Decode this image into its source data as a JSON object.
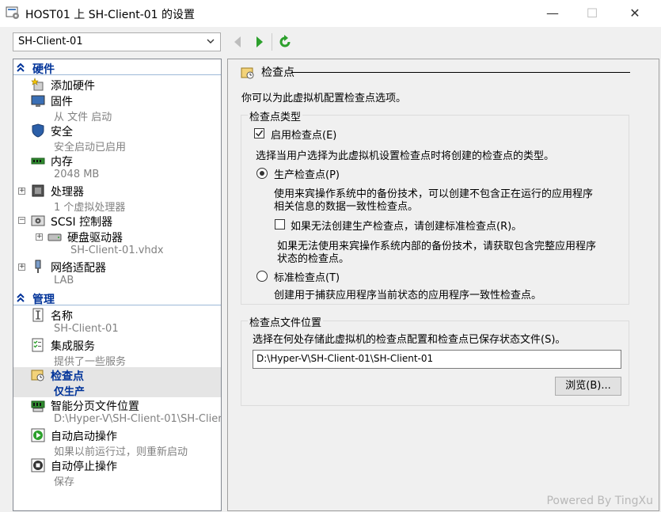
{
  "window": {
    "title": "HOST01 上 SH-Client-01 的设置",
    "minimize": "—",
    "maximize": "☐",
    "close": "✕"
  },
  "vm_selector": {
    "value": "SH-Client-01"
  },
  "sidebar": {
    "hardware_header": "硬件",
    "management_header": "管理",
    "items": [
      {
        "name": "添加硬件",
        "sub": ""
      },
      {
        "name": "固件",
        "sub": "从 文件 启动"
      },
      {
        "name": "安全",
        "sub": "安全启动已启用"
      },
      {
        "name": "内存",
        "sub": "2048 MB"
      },
      {
        "name": "处理器",
        "sub": "1 个虚拟处理器"
      },
      {
        "name": "SCSI 控制器",
        "sub": ""
      },
      {
        "name": "硬盘驱动器",
        "sub": "SH-Client-01.vhdx"
      },
      {
        "name": "网络适配器",
        "sub": "LAB"
      },
      {
        "name": "名称",
        "sub": "SH-Client-01"
      },
      {
        "name": "集成服务",
        "sub": "提供了一些服务"
      },
      {
        "name": "检查点",
        "sub": "仅生产"
      },
      {
        "name": "智能分页文件位置",
        "sub": "D:\\Hyper-V\\SH-Client-01\\SH-Client..."
      },
      {
        "name": "自动启动操作",
        "sub": "如果以前运行过，则重新启动"
      },
      {
        "name": "自动停止操作",
        "sub": "保存"
      }
    ]
  },
  "main": {
    "title": "检查点",
    "description": "你可以为此虚拟机配置检查点选项。",
    "type_group": {
      "legend": "检查点类型",
      "enable_label": "启用检查点(E)",
      "enable_checked": true,
      "instruction": "选择当用户选择为此虚拟机设置检查点时将创建的检查点的类型。",
      "production_label": "生产检查点(P)",
      "production_desc_1": "使用来宾操作系统中的备份技术，可以创建不包含正在运行的应用程序",
      "production_desc_2": "相关信息的数据一致性检查点。",
      "fallback_label": "如果无法创建生产检查点，请创建标准检查点(R)。",
      "fallback_checked": false,
      "fallback_desc_1": "如果无法使用来宾操作系统内部的备份技术，请获取包含完整应用程序",
      "fallback_desc_2": "状态的检查点。",
      "standard_label": "标准检查点(T)",
      "standard_desc": "创建用于捕获应用程序当前状态的应用程序一致性检查点。",
      "selected": "production"
    },
    "location_group": {
      "legend": "检查点文件位置",
      "instruction": "选择在何处存储此虚拟机的检查点配置和检查点已保存状态文件(S)。",
      "path": "D:\\Hyper-V\\SH-Client-01\\SH-Client-01",
      "browse_label": "浏览(B)..."
    }
  },
  "watermark": "Powered By TingXu",
  "colors": {
    "accent": "#003399",
    "selected_bg": "#e5e5e5",
    "nav_green": "#2ca02c"
  }
}
